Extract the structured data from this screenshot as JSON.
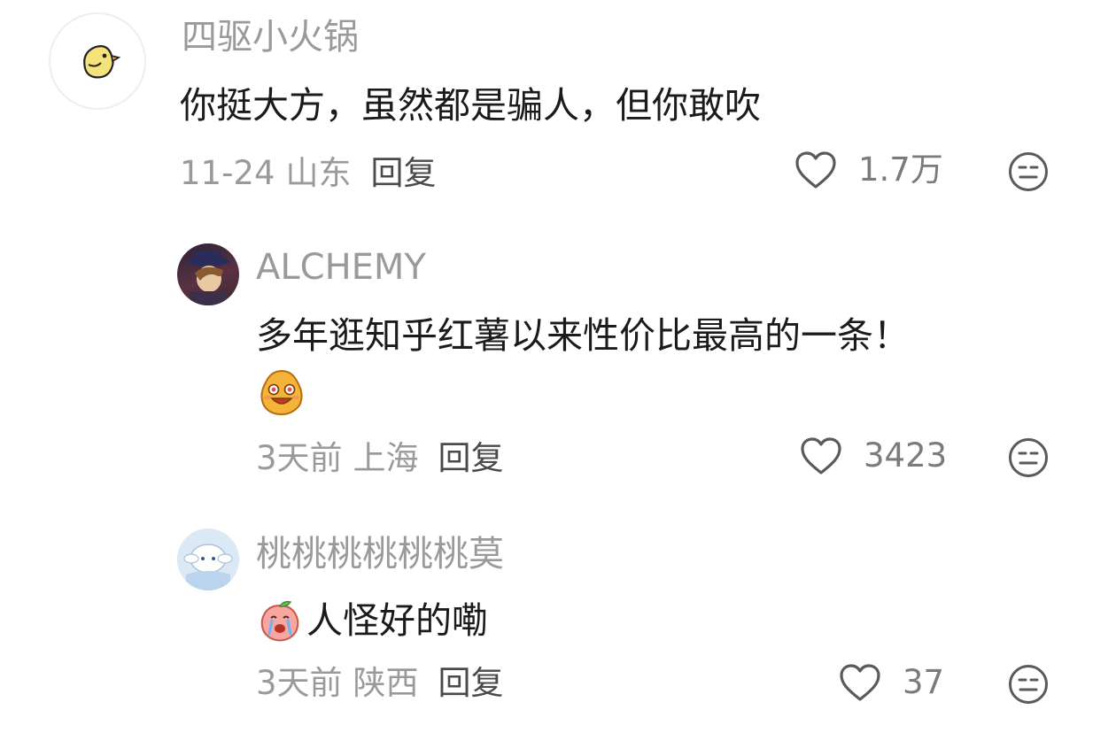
{
  "comments": [
    {
      "username": "四驱小火锅",
      "text": "你挺大方，虽然都是骗人，但你敢吹",
      "date": "11-24",
      "location": "山东",
      "reply_label": "回复",
      "likes": "1.7万"
    },
    {
      "username": "ALCHEMY",
      "text": "多年逛知乎红薯以来性价比最高的一条！",
      "date": "3天前",
      "location": "上海",
      "reply_label": "回复",
      "likes": "3423"
    },
    {
      "username": "桃桃桃桃桃桃莫",
      "text": "人怪好的嘞",
      "date": "3天前",
      "location": "陕西",
      "reply_label": "回复",
      "likes": "37"
    }
  ],
  "icons": {
    "like": "heart-outline-icon",
    "dislike": "neutral-face-icon"
  },
  "colors": {
    "text": "#1b1b1b",
    "muted": "#9a9a9a",
    "icon": "#5a5a5a"
  }
}
